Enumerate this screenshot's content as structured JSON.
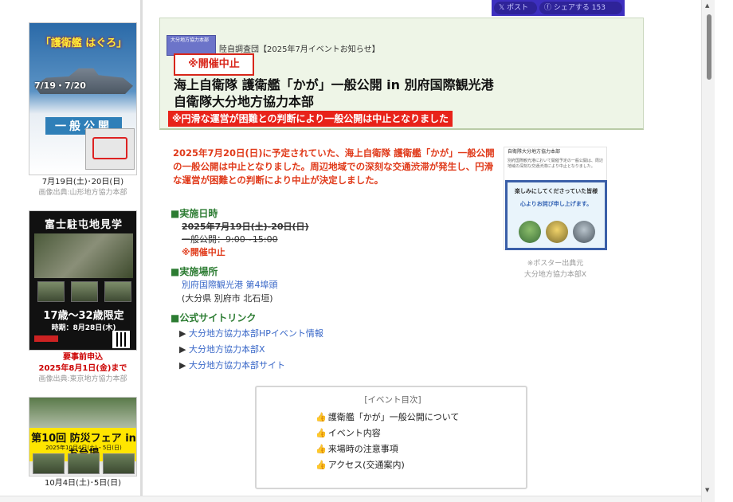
{
  "share": {
    "x_label": "ポスト",
    "fb_label": "シェアする 153"
  },
  "sidebar": {
    "cards": [
      {
        "poster_title": "「護衛艦 はぐろ」",
        "poster_date": "7/19・7/20",
        "poster_open": "一般公開",
        "date": "7月19日(土)･20日(日)",
        "source": "画像出典:山形地方協力本部"
      },
      {
        "poster_title": "富士駐屯地見学",
        "poster_age": "17歳～32歳限定",
        "poster_period": "時期：8月28日(木)",
        "note1": "要事前申込",
        "note2": "2025年8月1日(金)まで",
        "source": "画像出典:東京地方協力本部"
      },
      {
        "poster_title": "第10回 防災フェア in お台場",
        "poster_sub": "2025年10月4日(土)・5日(日)",
        "date": "10月4日(土)･5日(日)"
      }
    ]
  },
  "banner": {
    "kicker": "陸自調査団【2025年7月イベントお知らせ】",
    "logo_text": "大分地方協力本部",
    "cancel_badge": "※開催中止",
    "headline_line1": "海上自衛隊 護衛艦「かが」一般公開 in 別府国際観光港",
    "headline_line2": "自衛隊大分地方協力本部",
    "notice_bar": "※円滑な運営が困難との判断により一般公開は中止となりました"
  },
  "notice_text": "2025年7月20日(日)に予定されていた、海上自衛隊 護衛艦「かが」一般公開の一般公開は中止となりました。周辺地域での深刻な交通渋滞が発生し、円滑な運営が困難との判断により中止が決定しました。",
  "schedule": {
    "heading": "■実施日時",
    "date_struck": "2025年7月19日(土)-20日(日)",
    "time_struck": "一般公開：9:00~15:00",
    "cancel_note": "※開催中止"
  },
  "venue": {
    "heading": "■実施場所",
    "place": "別府国際観光港 第4埠頭",
    "address": "(大分県 別府市 北石垣)"
  },
  "links": {
    "heading": "■公式サイトリンク",
    "bullet": "▶",
    "items": [
      "大分地方協力本部HPイベント情報",
      "大分地方協力本部X",
      "大分地方協力本部サイト"
    ]
  },
  "poster": {
    "head": "自衛隊大分地方協力本部",
    "body": "別府国際観光港において開催予定の一般公開は、周辺地域の深刻な交通渋滞により中止となりました。",
    "box_line1": "楽しみにしてくださっていた皆様",
    "box_line2": "心よりお詫び申し上げます。",
    "caption_line1": "※ポスター出典元",
    "caption_line2": "大分地方協力本部X"
  },
  "toc": {
    "title": "[イベント目次]",
    "hand_icon": "👍",
    "items": [
      "護衛艦「かが」一般公開について",
      "イベント内容",
      "来場時の注意事項",
      "アクセス(交通案内)"
    ]
  },
  "colors": {
    "accent_green": "#2c7c32",
    "alert_red": "#e8231a",
    "link_blue": "#3a68c8"
  }
}
